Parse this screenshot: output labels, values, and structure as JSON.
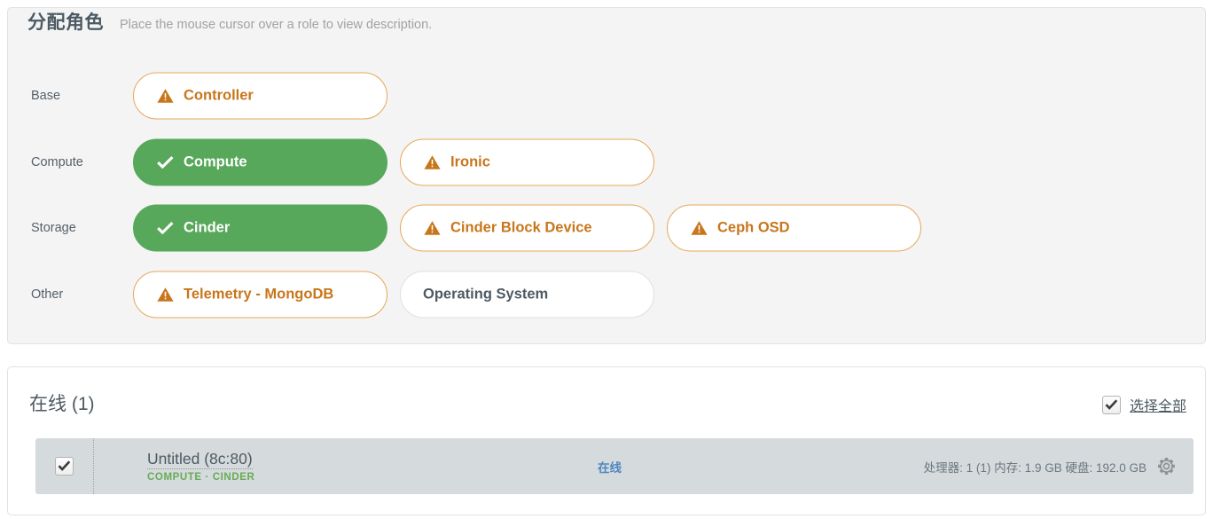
{
  "roles_panel": {
    "title": "分配角色",
    "hint": "Place the mouse cursor over a role to view description.",
    "rows": [
      {
        "label": "Base",
        "roles": [
          {
            "name": "Controller",
            "state": "warning",
            "icon": "warning-triangle-icon"
          }
        ]
      },
      {
        "label": "Compute",
        "roles": [
          {
            "name": "Compute",
            "state": "selected",
            "icon": "check-icon"
          },
          {
            "name": "Ironic",
            "state": "warning",
            "icon": "warning-triangle-icon"
          }
        ]
      },
      {
        "label": "Storage",
        "roles": [
          {
            "name": "Cinder",
            "state": "selected",
            "icon": "check-icon"
          },
          {
            "name": "Cinder Block Device",
            "state": "warning",
            "icon": "warning-triangle-icon"
          },
          {
            "name": "Ceph OSD",
            "state": "warning",
            "icon": "warning-triangle-icon"
          }
        ]
      },
      {
        "label": "Other",
        "roles": [
          {
            "name": "Telemetry - MongoDB",
            "state": "warning",
            "icon": "warning-triangle-icon"
          },
          {
            "name": "Operating System",
            "state": "plain",
            "icon": "none"
          }
        ]
      }
    ]
  },
  "nodes_panel": {
    "title": "在线 (1)",
    "select_all_label": "选择全部",
    "select_all_checked": true,
    "nodes": [
      {
        "checked": true,
        "name": "Untitled (8c:80)",
        "roles": "COMPUTE · CINDER",
        "status": "在线",
        "hardware": "处理器: 1 (1) 内存: 1.9 GB 硬盘: 192.0 GB",
        "settings_icon": "gear-icon"
      }
    ]
  },
  "colors": {
    "warning": "#c8761b",
    "warning_border": "#e6a759",
    "selected_green": "#57a85a",
    "role_tag_green": "#68ab56",
    "status_blue": "#4f86c0",
    "panel_bg": "#f4f4f4",
    "row_bg": "#d5dadc"
  }
}
